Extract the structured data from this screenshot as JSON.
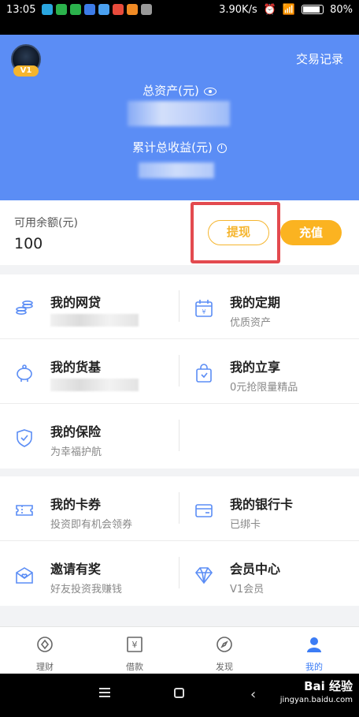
{
  "status_bar": {
    "time": "13:05",
    "network_speed": "3.90K/s",
    "battery": "80%"
  },
  "header": {
    "vip_label": "V1",
    "transaction_record": "交易记录",
    "total_assets_label": "总资产(元)",
    "cumulative_earnings_label": "累计总收益(元)"
  },
  "balance": {
    "label": "可用余额(元)",
    "value": "100",
    "withdraw_label": "提现",
    "recharge_label": "充值"
  },
  "grid1": [
    {
      "title": "我的网贷",
      "sub": "",
      "icon": "coins-icon"
    },
    {
      "title": "我的定期",
      "sub": "优质资产",
      "icon": "calendar-icon"
    },
    {
      "title": "我的货基",
      "sub": "",
      "icon": "piggy-bank-icon"
    },
    {
      "title": "我的立享",
      "sub": "0元抢限量精品",
      "icon": "shopping-bag-icon"
    },
    {
      "title": "我的保险",
      "sub": "为幸福护航",
      "icon": "shield-icon"
    }
  ],
  "grid2": [
    {
      "title": "我的卡券",
      "sub": "投资即有机会领券",
      "icon": "ticket-icon"
    },
    {
      "title": "我的银行卡",
      "sub": "已绑卡",
      "icon": "bank-card-icon"
    },
    {
      "title": "邀请有奖",
      "sub": "好友投资我赚钱",
      "icon": "invite-letter-icon"
    },
    {
      "title": "会员中心",
      "sub": "V1会员",
      "icon": "diamond-icon"
    }
  ],
  "tabbar": [
    {
      "label": "理财",
      "icon": "wealth-icon"
    },
    {
      "label": "借款",
      "icon": "loan-icon"
    },
    {
      "label": "发现",
      "icon": "compass-icon"
    },
    {
      "label": "我的",
      "icon": "profile-icon"
    }
  ],
  "watermark": {
    "text": "Bai 经验",
    "sub": "jingyan.baidu.com"
  },
  "colors": {
    "primary": "#5b8df5",
    "accent": "#fbb321",
    "highlight": "#e34a4f",
    "tab_active": "#3b7cf5"
  }
}
